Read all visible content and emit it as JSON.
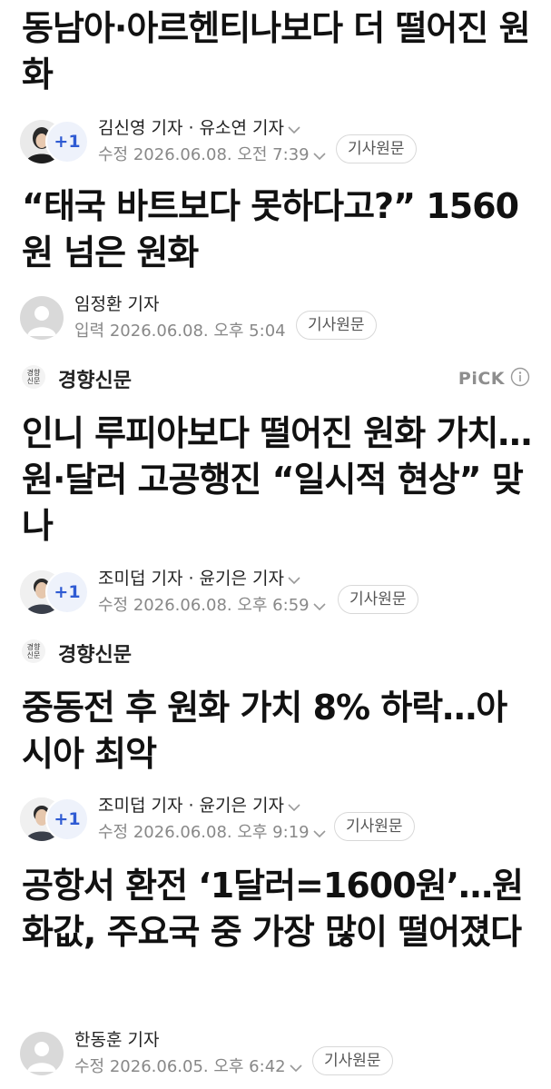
{
  "articles": [
    {
      "headline": "동남아·아르헨티나보다 더 떨어진 원화",
      "reporters": "김신영 기자 · 유소연 기자",
      "badge": "+1",
      "timestamp": "수정 2026.06.08. 오전 7:39",
      "original_label": "기사원문"
    },
    {
      "headline": "“태국 바트보다 못하다고?” 1560원 넘은 원화",
      "reporters": "임정환 기자",
      "timestamp": "입력 2026.06.08. 오후 5:04",
      "original_label": "기사원문"
    },
    {
      "press": "경향신문",
      "press_logo": "경향\n신문",
      "pick": "PiCK",
      "headline": "인니 루피아보다 떨어진 원화 가치…원·달러 고공행진 “일시적 현상” 맞나",
      "reporters": "조미덥 기자 · 윤기은 기자",
      "badge": "+1",
      "timestamp": "수정 2026.06.08. 오후 6:59",
      "original_label": "기사원문"
    },
    {
      "press": "경향신문",
      "press_logo": "경향\n신문",
      "headline": "중동전 후 원화 가치 8% 하락…아시아 최악",
      "reporters": "조미덥 기자 · 윤기은 기자",
      "badge": "+1",
      "timestamp": "수정 2026.06.08. 오후 9:19",
      "original_label": "기사원문"
    },
    {
      "headline": "공항서 환전 ‘1달러=1600원’…원화값, 주요국 중 가장 많이 떨어졌다",
      "reporters": "한동훈 기자",
      "timestamp": "수정 2026.06.05. 오후 6:42",
      "original_label": "기사원문"
    }
  ],
  "icons": {
    "chevron": "chevron-down-icon",
    "info": "info-icon",
    "avatar_default": "default-avatar-icon"
  },
  "colors": {
    "badge_text": "#2f5bd3",
    "meta_text": "#888888"
  }
}
